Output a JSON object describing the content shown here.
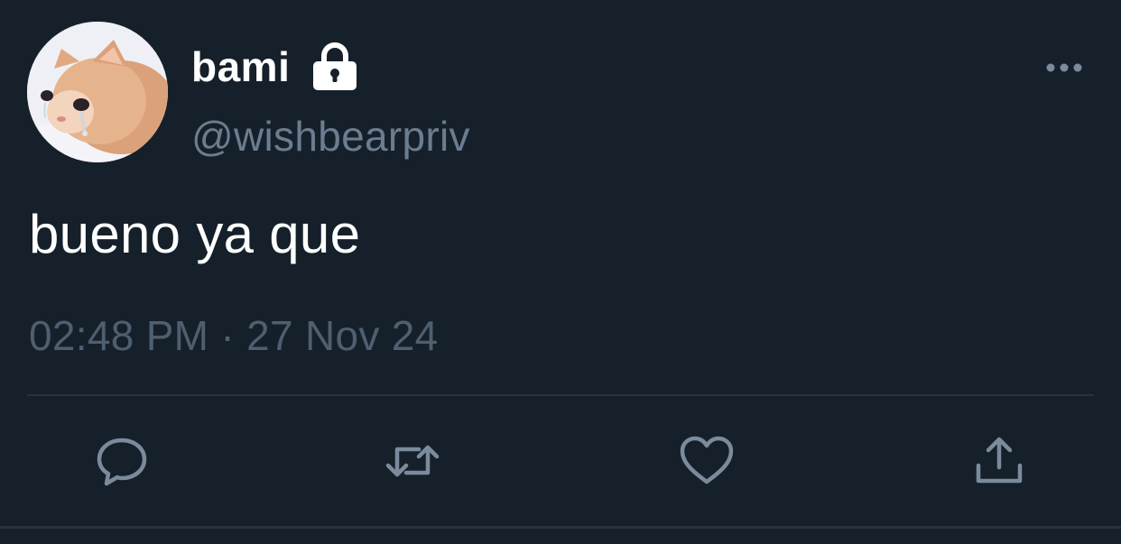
{
  "tweet": {
    "display_name": "bami",
    "handle": "@wishbearpriv",
    "protected_icon": "lock-icon",
    "text": "bueno ya que",
    "time": "02:48 PM",
    "separator": "·",
    "date": "27 Nov 24"
  },
  "actions": {
    "reply_icon": "comment-icon",
    "retweet_icon": "retweet-icon",
    "like_icon": "heart-icon",
    "share_icon": "share-icon",
    "more_icon": "more-horizontal-icon"
  },
  "colors": {
    "background": "#16202b",
    "primary_text": "#ffffff",
    "secondary_text": "#6b7d8f",
    "muted_text": "#4e5f70",
    "icon": "#7b8b9c",
    "divider": "#26323f"
  }
}
